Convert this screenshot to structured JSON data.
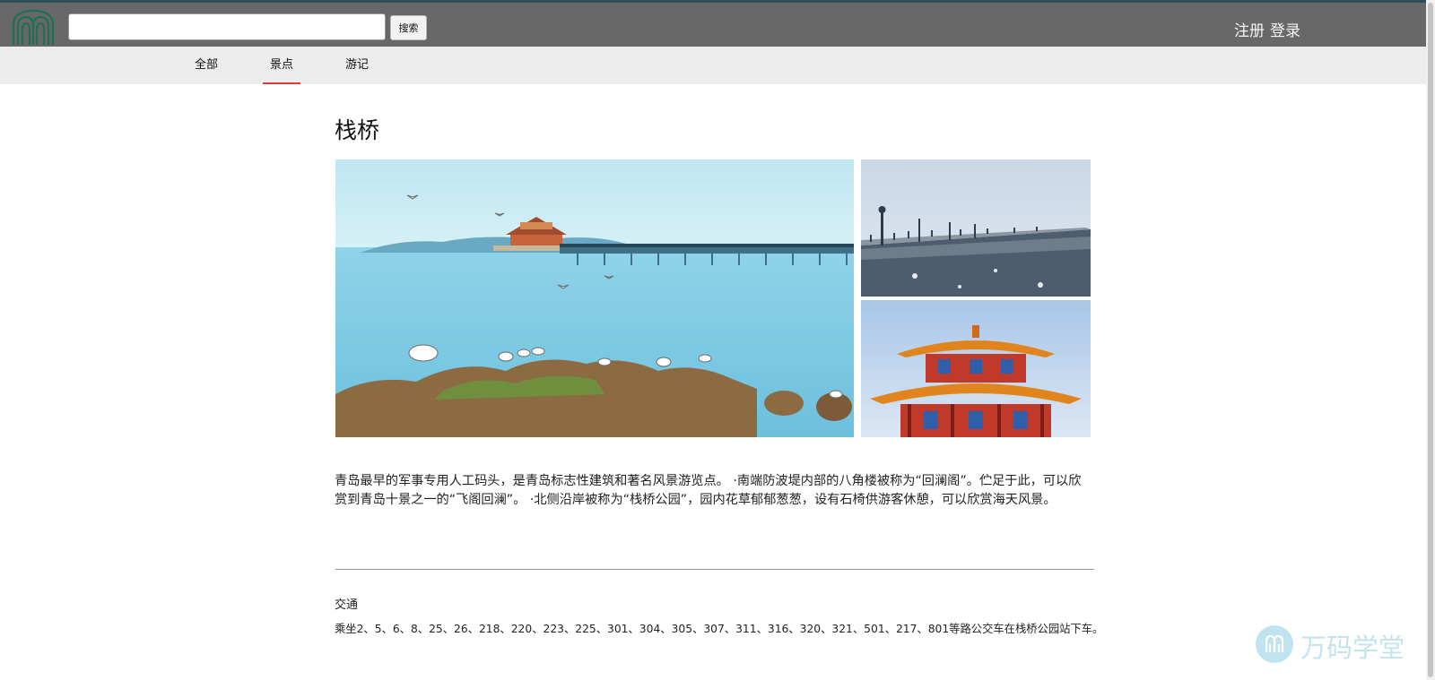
{
  "header": {
    "logo_icon": "logo-arch-icon",
    "search": {
      "value": "",
      "placeholder": "",
      "button_label": "搜索"
    },
    "register_label": "注册",
    "login_label": "登录"
  },
  "nav": {
    "tabs": [
      {
        "label": "全部",
        "active": false
      },
      {
        "label": "景点",
        "active": true
      },
      {
        "label": "游记",
        "active": false
      }
    ]
  },
  "attraction": {
    "title": "栈桥",
    "description": "青岛最早的军事专用人工码头，是青岛标志性建筑和著名风景游览点。 ·南端防波堤内部的八角楼被称为“回澜阁”。伫足于此，可以欣赏到青岛十景之一的“飞阁回澜”。 ·北侧沿岸被称为“栈桥公园”，园内花草郁郁葱葱，设有石椅供游客休憩，可以欣赏海天风景。",
    "transport": {
      "label": "交通",
      "text": "乘坐2、5、6、8、25、26、218、220、223、225、301、304、305、307、311、316、320、321、501、217、801等路公交车在栈桥公园站下车。"
    }
  },
  "watermark": {
    "icon": "wanma-logo-icon",
    "text": "万码学堂"
  },
  "colors": {
    "header_bg": "#686868",
    "subnav_bg": "#ececec",
    "active_tab_underline": "#e53935",
    "logo_green": "#1f6e55",
    "watermark": "#bfe4f0"
  }
}
